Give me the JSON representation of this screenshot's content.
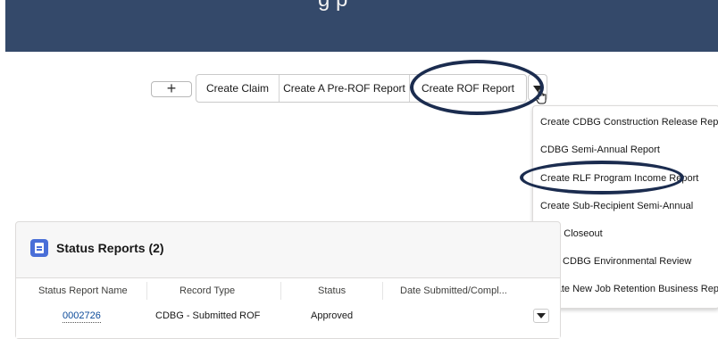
{
  "header": {
    "partial_text": "g            p"
  },
  "toolbar": {
    "add_label": "+",
    "create_claim": "Create Claim",
    "create_pre_rof": "Create A Pre-ROF Report",
    "create_rof": "Create ROF Report"
  },
  "menu": {
    "items": [
      "Create CDBG Construction Release Report",
      "CDBG Semi-Annual Report",
      "Create RLF Program Income Report",
      "Create Sub-Recipient Semi-Annual",
      "Start Closeout",
      "New CDBG Environmental Review",
      "Create New Job Retention Business Report"
    ]
  },
  "status_reports": {
    "title": "Status Reports (2)",
    "columns": [
      "Status Report Name",
      "Record Type",
      "Status",
      "Date Submitted/Compl..."
    ],
    "rows": [
      {
        "name": "0002726",
        "record_type": "CDBG - Submitted ROF",
        "status": "Approved",
        "date": ""
      }
    ]
  },
  "colors": {
    "header_bg": "#34496a",
    "annotation_oval": "#1b2c4f",
    "card_icon": "#4a6fd8",
    "link": "#0b4a9a"
  },
  "icons": [
    "plus-icon",
    "chevron-down-icon",
    "hand-cursor-icon",
    "report-icon"
  ]
}
